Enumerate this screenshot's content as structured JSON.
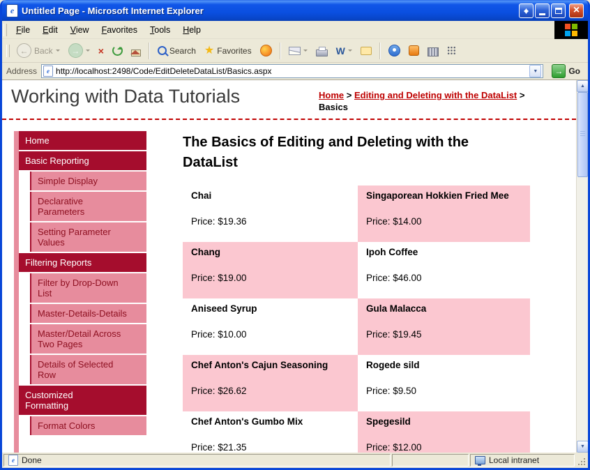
{
  "window": {
    "title": "Untitled Page - Microsoft Internet Explorer",
    "colors": {
      "titlebar_blue": "#0A4FE0",
      "chrome_gray": "#ECE9D8",
      "nav_dark_red": "#A50D2D",
      "nav_pink": "#E78C9D",
      "product_pink": "#FBC7D0",
      "link_red": "#BE0000",
      "go_green": "#2F9E2F"
    }
  },
  "menu": {
    "items": [
      "File",
      "Edit",
      "View",
      "Favorites",
      "Tools",
      "Help"
    ]
  },
  "toolbar": {
    "back_label": "Back",
    "search_label": "Search",
    "favorites_label": "Favorites"
  },
  "address_bar": {
    "label": "Address",
    "url": "http://localhost:2498/Code/EditDeleteDataList/Basics.aspx",
    "go_label": "Go"
  },
  "header": {
    "site_title": "Working with Data Tutorials",
    "breadcrumb": {
      "home": "Home",
      "sep1": ">",
      "section": "Editing and Deleting with the DataList",
      "sep2": ">",
      "current": "Basics"
    }
  },
  "sidebar": {
    "items": [
      {
        "label": "Home"
      },
      {
        "label": "Basic Reporting"
      },
      {
        "label": "Simple Display"
      },
      {
        "label": "Declarative Parameters"
      },
      {
        "label": "Setting Parameter Values"
      },
      {
        "label": "Filtering Reports"
      },
      {
        "label": "Filter by Drop-Down List"
      },
      {
        "label": "Master-Details-Details"
      },
      {
        "label": "Master/Detail Across Two Pages"
      },
      {
        "label": "Details of Selected Row"
      },
      {
        "label": "Customized Formatting"
      },
      {
        "label": "Format Colors"
      }
    ]
  },
  "main": {
    "heading": "The Basics of Editing and Deleting with the DataList",
    "products": [
      {
        "name": "Chai",
        "price": "Price: $19.36"
      },
      {
        "name": "Singaporean Hokkien Fried Mee",
        "price": "Price: $14.00"
      },
      {
        "name": "Chang",
        "price": "Price: $19.00"
      },
      {
        "name": "Ipoh Coffee",
        "price": "Price: $46.00"
      },
      {
        "name": "Aniseed Syrup",
        "price": "Price: $10.00"
      },
      {
        "name": "Gula Malacca",
        "price": "Price: $19.45"
      },
      {
        "name": "Chef Anton's Cajun Seasoning",
        "price": "Price: $26.62"
      },
      {
        "name": "Rogede sild",
        "price": "Price: $9.50"
      },
      {
        "name": "Chef Anton's Gumbo Mix",
        "price": "Price: $21.35"
      },
      {
        "name": "Spegesild",
        "price": "Price: $12.00"
      }
    ]
  },
  "status_bar": {
    "left": "Done",
    "zone": "Local intranet"
  }
}
